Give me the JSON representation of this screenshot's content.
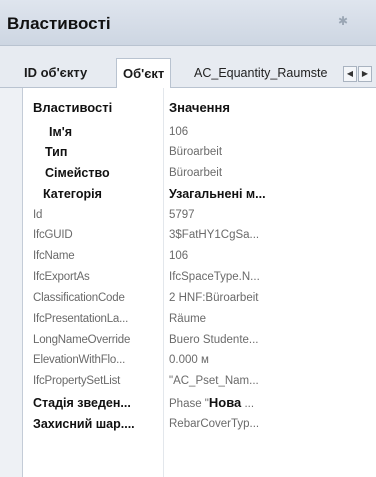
{
  "panel": {
    "title": "Властивості",
    "pin_icon": "pin-icon"
  },
  "tabs": [
    {
      "label": "ID об'єкту"
    },
    {
      "label": "Об'єкт"
    },
    {
      "label": "AC_Equantity_Raumste"
    }
  ],
  "grid": {
    "header": {
      "name": "Властивості",
      "value": "Значення"
    },
    "rows": [
      {
        "name": "Ім'я",
        "value": "106"
      },
      {
        "name": "Тип",
        "value": "Büroarbeit"
      },
      {
        "name": "Сімейство",
        "value": "Büroarbeit"
      },
      {
        "name": "Категорія",
        "value": "Узагальнені м..."
      },
      {
        "name": "Id",
        "value": "5797"
      },
      {
        "name": "IfcGUID",
        "value": "3$FatHY1CgSa..."
      },
      {
        "name": "IfcName",
        "value": "106"
      },
      {
        "name": "IfcExportAs",
        "value": "IfcSpaceType.N..."
      },
      {
        "name": "ClassificationCode",
        "value": "2 HNF:Büroarbeit"
      },
      {
        "name": "IfcPresentationLa...",
        "value": "Räume"
      },
      {
        "name": "LongNameOverride",
        "value": "Buero Studente..."
      },
      {
        "name": "ElevationWithFlo...",
        "value": "0.000 м"
      },
      {
        "name": "IfcPropertySetList",
        "value": "\"AC_Pset_Nam..."
      },
      {
        "name": "Стадія зведен...",
        "value_prefix": "Phase \"",
        "value_bold": "Нова",
        "value_suffix": " ..."
      },
      {
        "name": "Захисний шар....",
        "value": "RebarCoverTyp..."
      }
    ]
  }
}
